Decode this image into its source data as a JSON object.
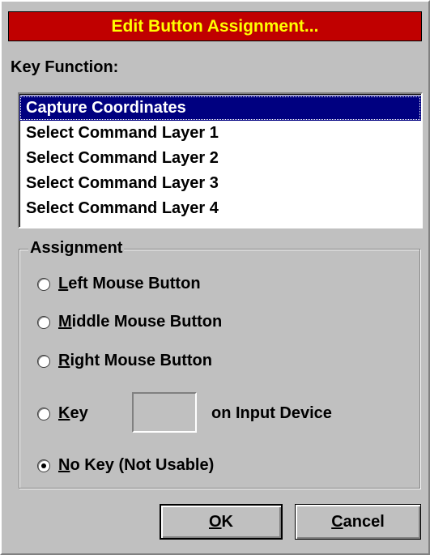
{
  "dialog": {
    "title": "Edit Button Assignment...",
    "title_bar_color": "#c00000",
    "title_text_color": "#ffff00"
  },
  "key_function": {
    "label": "Key Function:",
    "items": [
      "Capture Coordinates",
      "Select Command Layer 1",
      "Select Command Layer 2",
      "Select Command Layer 3",
      "Select Command Layer 4"
    ],
    "selected": "Capture Coordinates",
    "selection_color": "#000080"
  },
  "assignment": {
    "legend": "Assignment",
    "options": {
      "left_mouse": {
        "mnemonic": "L",
        "rest": "eft Mouse Button",
        "checked": false
      },
      "middle_mouse": {
        "mnemonic": "M",
        "rest": "iddle Mouse Button",
        "checked": false
      },
      "right_mouse": {
        "mnemonic": "R",
        "rest": "ight Mouse Button",
        "checked": false
      },
      "key": {
        "mnemonic": "K",
        "rest": "ey",
        "checked": false
      },
      "no_key": {
        "mnemonic": "N",
        "rest": "o Key (Not Usable)",
        "checked": true
      }
    },
    "key_value": "",
    "input_device_label": "on Input Device"
  },
  "buttons": {
    "ok": {
      "mnemonic": "O",
      "rest": "K"
    },
    "cancel": {
      "mnemonic": "C",
      "rest": "ancel"
    }
  }
}
